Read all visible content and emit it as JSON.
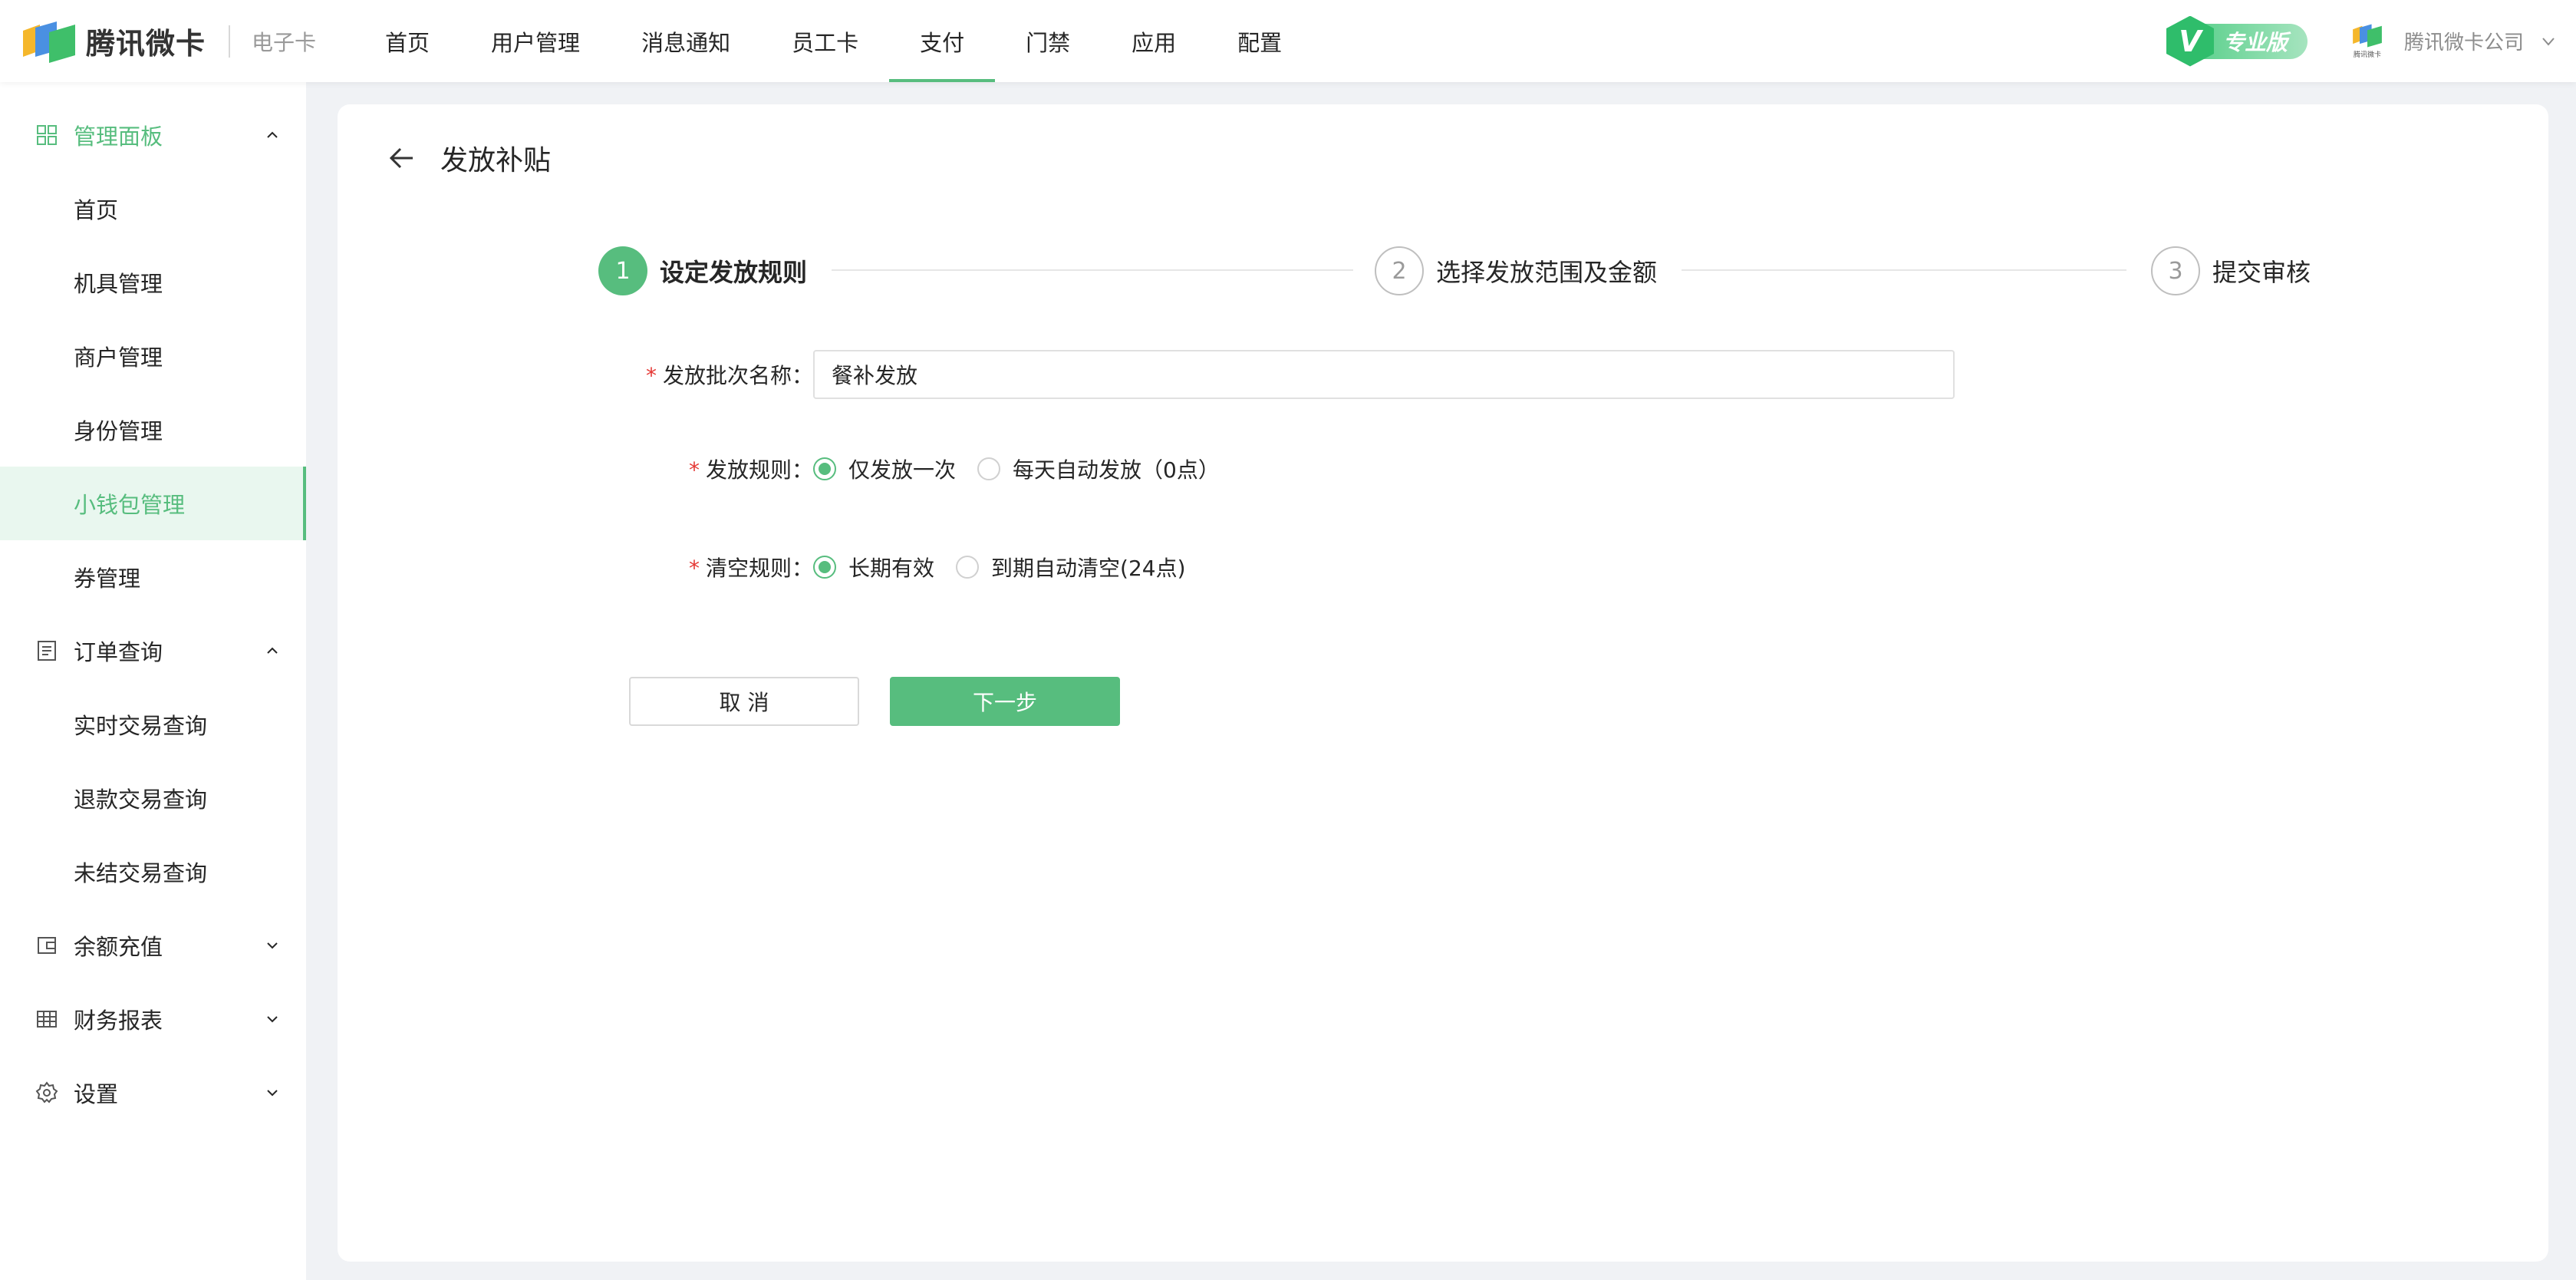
{
  "header": {
    "brand": "腾讯微卡",
    "sub_brand": "电子卡",
    "nav": [
      {
        "label": "首页"
      },
      {
        "label": "用户管理"
      },
      {
        "label": "消息通知"
      },
      {
        "label": "员工卡"
      },
      {
        "label": "支付",
        "active": true
      },
      {
        "label": "门禁"
      },
      {
        "label": "应用"
      },
      {
        "label": "配置"
      }
    ],
    "edition_letter": "V",
    "edition": "专业版",
    "company_logo_text": "腾讯微卡",
    "company": "腾讯微卡公司"
  },
  "sidebar": {
    "groups": [
      {
        "label": "管理面板",
        "icon": "grid-icon",
        "expanded": true,
        "items": [
          "首页",
          "机具管理",
          "商户管理",
          "身份管理",
          "小钱包管理",
          "券管理"
        ],
        "active_item": "小钱包管理"
      },
      {
        "label": "订单查询",
        "icon": "receipt-icon",
        "expanded": true,
        "items": [
          "实时交易查询",
          "退款交易查询",
          "未结交易查询"
        ]
      },
      {
        "label": "余额充值",
        "icon": "wallet-icon",
        "expanded": false
      },
      {
        "label": "财务报表",
        "icon": "table-icon",
        "expanded": false
      },
      {
        "label": "设置",
        "icon": "gear-icon",
        "expanded": false
      }
    ]
  },
  "page": {
    "title": "发放补贴",
    "steps": [
      {
        "num": "1",
        "label": "设定发放规则",
        "status": "current"
      },
      {
        "num": "2",
        "label": "选择发放范围及金额",
        "status": "pending"
      },
      {
        "num": "3",
        "label": "提交审核",
        "status": "pending"
      }
    ],
    "form": {
      "batch_name_label": "发放批次名称：",
      "batch_name_value": "餐补发放",
      "rule_label": "发放规则：",
      "rule_options": [
        "仅发放一次",
        "每天自动发放（0点）"
      ],
      "rule_selected": "仅发放一次",
      "clear_label": "清空规则：",
      "clear_options": [
        "长期有效",
        "到期自动清空(24点)"
      ],
      "clear_selected": "长期有效"
    },
    "buttons": {
      "cancel": "取 消",
      "next": "下一步"
    }
  },
  "colors": {
    "accent": "#57bd7e",
    "required": "#e53935",
    "active_bg": "#e9f7ef"
  }
}
